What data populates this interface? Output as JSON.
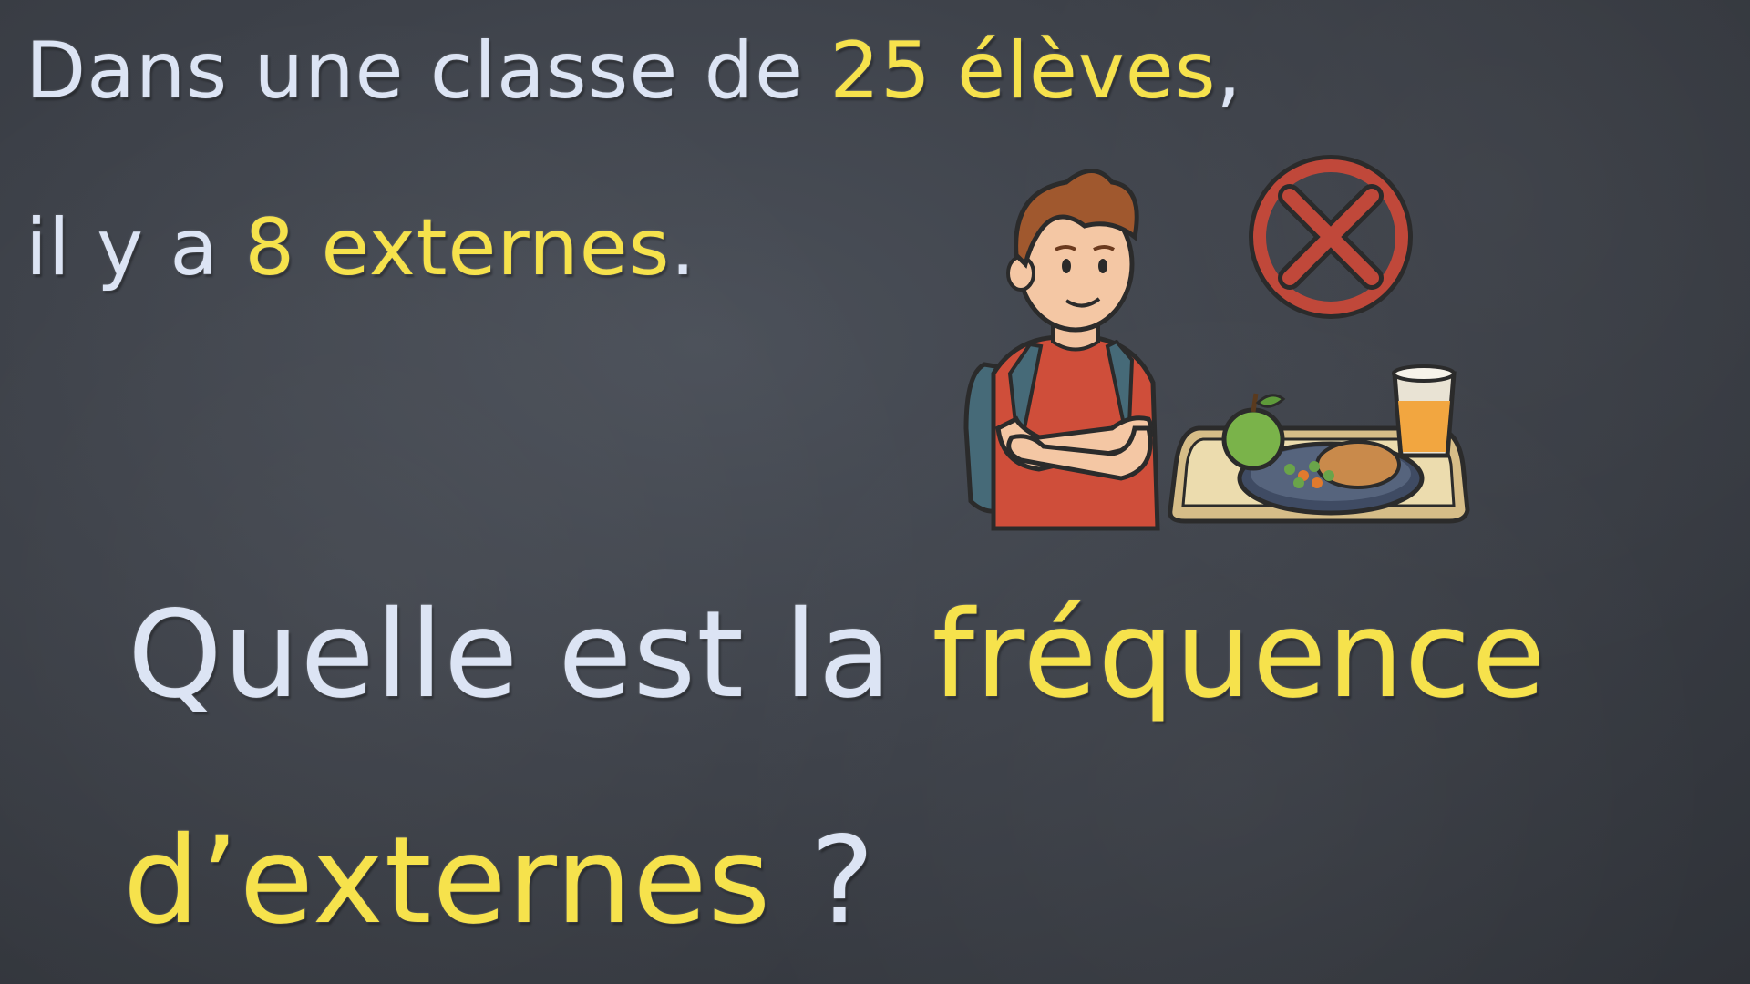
{
  "statement": {
    "line1_part1": "Dans une classe de ",
    "line1_highlight": "25 élèves",
    "line1_part2": ",",
    "line2_part1": "il y a ",
    "line2_highlight": "8 externes",
    "line2_part2": "."
  },
  "question": {
    "line1_part1": "Quelle est la ",
    "line1_highlight": "fréquence",
    "line2_highlight": "d’externes",
    "line2_part2": " ?"
  },
  "illustration": {
    "icons": [
      "student-icon",
      "no-symbol-icon",
      "lunch-tray-icon",
      "apple-icon",
      "juice-glass-icon"
    ]
  },
  "colors": {
    "background": "#3d4149",
    "text_light": "#dce4f4",
    "text_highlight": "#f6e24c"
  }
}
